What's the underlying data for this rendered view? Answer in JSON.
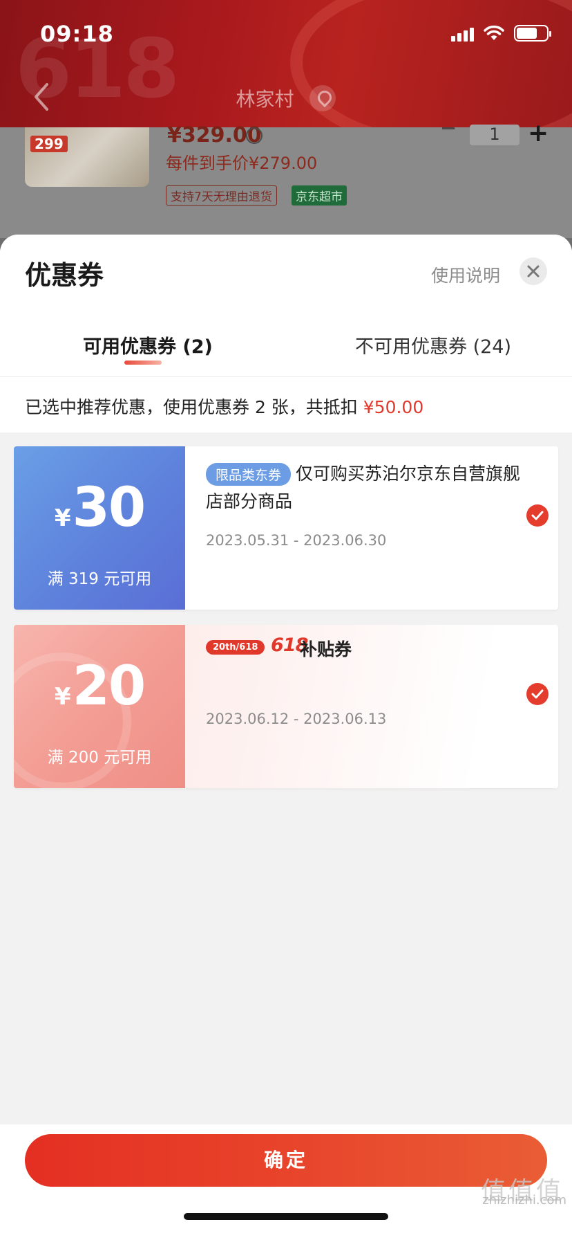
{
  "status_bar": {
    "time": "09:18"
  },
  "background": {
    "header_title": "林家村",
    "product": {
      "image_price_tag": "299",
      "price": "¥329.00",
      "unit_price": "每件到手价¥279.00",
      "tag_return": "支持7天无理由退货",
      "tag_store": "京东超市",
      "quantity": "1"
    }
  },
  "sheet": {
    "title": "优惠券",
    "usage_link": "使用说明",
    "tabs": [
      {
        "label": "可用优惠券 (2)",
        "active": true
      },
      {
        "label": "不可用优惠券 (24)",
        "active": false
      }
    ],
    "summary_text": "已选中推荐优惠，使用优惠券 2 张，共抵扣",
    "summary_amount": "¥50.00"
  },
  "coupons": [
    {
      "currency": "¥",
      "amount": "30",
      "condition": "满 319 元可用",
      "badge": "限品类东券",
      "description": "仅可购买苏泊尔京东自营旗舰店部分商品",
      "date_range": "2023.05.31 - 2023.06.30",
      "selected": true,
      "color": "#5e82dc"
    },
    {
      "currency": "¥",
      "amount": "20",
      "condition": "满 200 元可用",
      "badge": "20th/618",
      "brand": "618",
      "title": "补贴券",
      "date_range": "2023.06.12 - 2023.06.13",
      "selected": true,
      "color": "#f39d94"
    }
  ],
  "footer": {
    "confirm_label": "确定"
  },
  "watermark": {
    "glyphs": "值值值",
    "site": "zhizhizhi.com"
  },
  "colors": {
    "accent": "#e42f22",
    "price": "#e2392c"
  }
}
